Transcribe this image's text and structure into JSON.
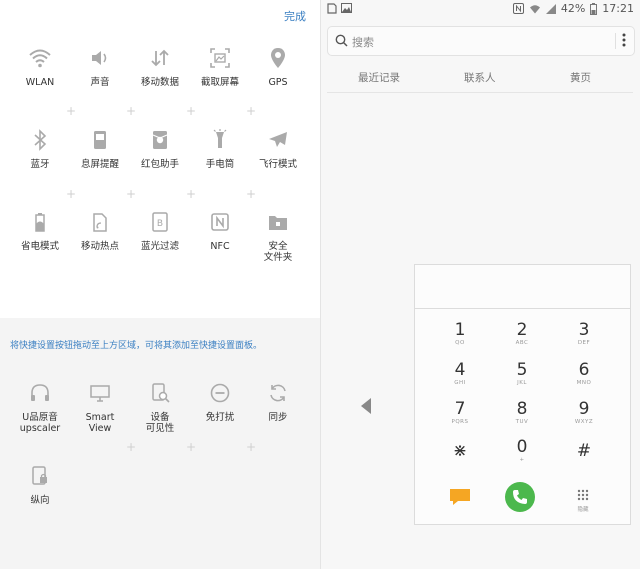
{
  "panel": {
    "done_label": "完成",
    "active_tiles": [
      {
        "label": "WLAN",
        "icon": "wifi-icon"
      },
      {
        "label": "声音",
        "icon": "speaker-icon"
      },
      {
        "label": "移动数据",
        "icon": "data-transfer-icon"
      },
      {
        "label": "截取屏幕",
        "icon": "screenshot-icon"
      },
      {
        "label": "GPS",
        "icon": "location-pin-icon"
      },
      {
        "label": "蓝牙",
        "icon": "bluetooth-icon"
      },
      {
        "label": "息屏提醒",
        "icon": "always-on-display-icon"
      },
      {
        "label": "红包助手",
        "icon": "red-envelope-icon"
      },
      {
        "label": "手电筒",
        "icon": "flashlight-icon"
      },
      {
        "label": "飞行模式",
        "icon": "airplane-icon"
      },
      {
        "label": "省电模式",
        "icon": "battery-saver-icon"
      },
      {
        "label": "移动热点",
        "icon": "hotspot-icon"
      },
      {
        "label": "蓝光过滤",
        "icon": "blue-light-filter-icon"
      },
      {
        "label": "NFC",
        "icon": "nfc-icon"
      },
      {
        "label": "安全\n文件夹",
        "icon": "secure-folder-icon"
      }
    ],
    "hint": "将快捷设置按钮拖动至上方区域，可将其添加至快捷设置面板。",
    "available_tiles": [
      {
        "label": "U品原音\nupscaler",
        "icon": "headphones-icon"
      },
      {
        "label": "Smart\nView",
        "icon": "smart-view-icon"
      },
      {
        "label": "设备\n可见性",
        "icon": "device-visibility-icon"
      },
      {
        "label": "免打扰",
        "icon": "do-not-disturb-icon"
      },
      {
        "label": "同步",
        "icon": "sync-icon"
      },
      {
        "label": "纵向",
        "icon": "portrait-lock-icon"
      }
    ]
  },
  "status_bar": {
    "battery": "42%",
    "time": "17:21"
  },
  "dialer": {
    "search_placeholder": "搜索",
    "tabs": [
      "最近记录",
      "联系人",
      "黄页"
    ],
    "keys": [
      {
        "digit": "1",
        "sub": "QO"
      },
      {
        "digit": "2",
        "sub": "ABC"
      },
      {
        "digit": "3",
        "sub": "DEF"
      },
      {
        "digit": "4",
        "sub": "GHI"
      },
      {
        "digit": "5",
        "sub": "JKL"
      },
      {
        "digit": "6",
        "sub": "MNO"
      },
      {
        "digit": "7",
        "sub": "PQRS"
      },
      {
        "digit": "8",
        "sub": "TUV"
      },
      {
        "digit": "9",
        "sub": "WXYZ"
      },
      {
        "digit": "⋇",
        "sub": ""
      },
      {
        "digit": "0",
        "sub": "+"
      },
      {
        "digit": "#",
        "sub": ""
      }
    ],
    "hide_label": "隐藏"
  },
  "colors": {
    "accent": "#3a7fc2",
    "call_green": "#4cb84d",
    "message_orange": "#f5a623"
  }
}
